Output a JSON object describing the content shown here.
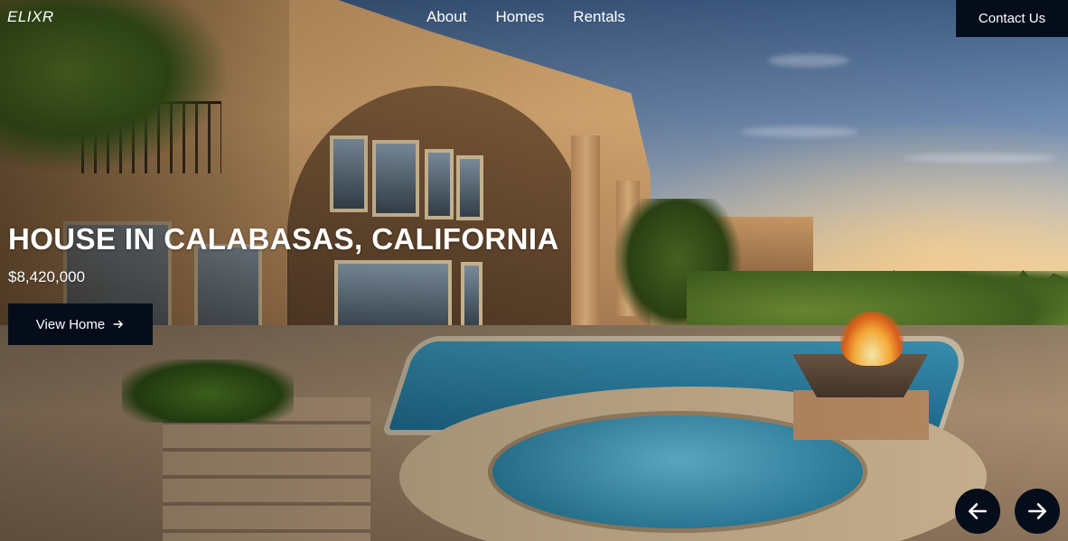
{
  "header": {
    "logo": "ELIXR",
    "nav": [
      {
        "label": "About"
      },
      {
        "label": "Homes"
      },
      {
        "label": "Rentals"
      }
    ],
    "contact_label": "Contact Us"
  },
  "hero": {
    "title": "HOUSE IN CALABASAS, CALIFORNIA",
    "price": "$8,420,000",
    "cta_label": "View Home",
    "cta_icon": "arrow-right-icon",
    "background_image": "luxury-house-with-pool-at-sunset"
  },
  "carousel": {
    "prev_icon": "arrow-left-icon",
    "next_icon": "arrow-right-icon"
  },
  "colors": {
    "button_bg": "#050d1b",
    "text": "#ffffff"
  }
}
